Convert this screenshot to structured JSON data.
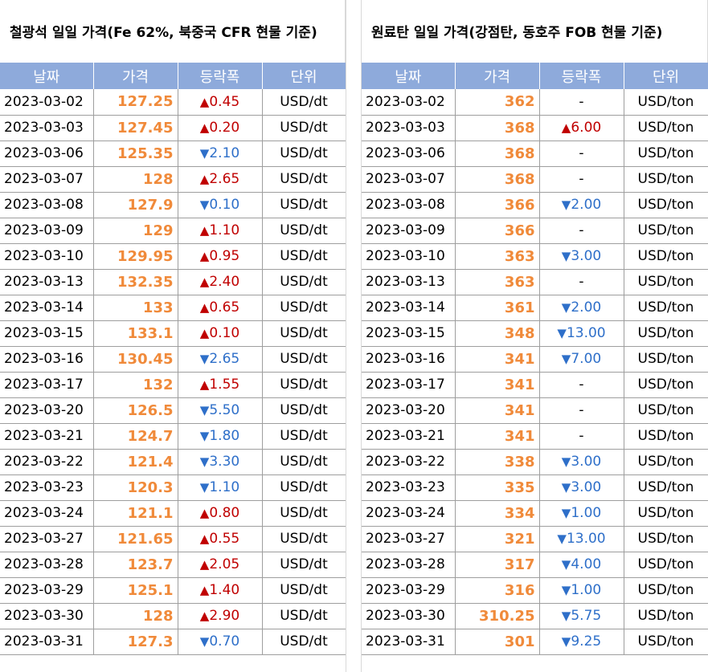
{
  "left": {
    "title": "철광석 일일 가격(Fe 62%, 북중국 CFR 현물 기준)",
    "headers": [
      "날짜",
      "가격",
      "등락폭",
      "단위"
    ],
    "rows": [
      {
        "date": "2023-03-02",
        "price": "127.25",
        "dir": "up",
        "change": "0.45",
        "unit": "USD/dt"
      },
      {
        "date": "2023-03-03",
        "price": "127.45",
        "dir": "up",
        "change": "0.20",
        "unit": "USD/dt"
      },
      {
        "date": "2023-03-06",
        "price": "125.35",
        "dir": "down",
        "change": "2.10",
        "unit": "USD/dt"
      },
      {
        "date": "2023-03-07",
        "price": "128",
        "dir": "up",
        "change": "2.65",
        "unit": "USD/dt"
      },
      {
        "date": "2023-03-08",
        "price": "127.9",
        "dir": "down",
        "change": "0.10",
        "unit": "USD/dt"
      },
      {
        "date": "2023-03-09",
        "price": "129",
        "dir": "up",
        "change": "1.10",
        "unit": "USD/dt"
      },
      {
        "date": "2023-03-10",
        "price": "129.95",
        "dir": "up",
        "change": "0.95",
        "unit": "USD/dt"
      },
      {
        "date": "2023-03-13",
        "price": "132.35",
        "dir": "up",
        "change": "2.40",
        "unit": "USD/dt"
      },
      {
        "date": "2023-03-14",
        "price": "133",
        "dir": "up",
        "change": "0.65",
        "unit": "USD/dt"
      },
      {
        "date": "2023-03-15",
        "price": "133.1",
        "dir": "up",
        "change": "0.10",
        "unit": "USD/dt"
      },
      {
        "date": "2023-03-16",
        "price": "130.45",
        "dir": "down",
        "change": "2.65",
        "unit": "USD/dt"
      },
      {
        "date": "2023-03-17",
        "price": "132",
        "dir": "up",
        "change": "1.55",
        "unit": "USD/dt"
      },
      {
        "date": "2023-03-20",
        "price": "126.5",
        "dir": "down",
        "change": "5.50",
        "unit": "USD/dt"
      },
      {
        "date": "2023-03-21",
        "price": "124.7",
        "dir": "down",
        "change": "1.80",
        "unit": "USD/dt"
      },
      {
        "date": "2023-03-22",
        "price": "121.4",
        "dir": "down",
        "change": "3.30",
        "unit": "USD/dt"
      },
      {
        "date": "2023-03-23",
        "price": "120.3",
        "dir": "down",
        "change": "1.10",
        "unit": "USD/dt"
      },
      {
        "date": "2023-03-24",
        "price": "121.1",
        "dir": "up",
        "change": "0.80",
        "unit": "USD/dt"
      },
      {
        "date": "2023-03-27",
        "price": "121.65",
        "dir": "up",
        "change": "0.55",
        "unit": "USD/dt"
      },
      {
        "date": "2023-03-28",
        "price": "123.7",
        "dir": "up",
        "change": "2.05",
        "unit": "USD/dt"
      },
      {
        "date": "2023-03-29",
        "price": "125.1",
        "dir": "up",
        "change": "1.40",
        "unit": "USD/dt"
      },
      {
        "date": "2023-03-30",
        "price": "128",
        "dir": "up",
        "change": "2.90",
        "unit": "USD/dt"
      },
      {
        "date": "2023-03-31",
        "price": "127.3",
        "dir": "down",
        "change": "0.70",
        "unit": "USD/dt"
      }
    ]
  },
  "right": {
    "title": "원료탄 일일 가격(강점탄, 동호주 FOB 현물 기준)",
    "headers": [
      "날짜",
      "가격",
      "등락폭",
      "단위"
    ],
    "rows": [
      {
        "date": "2023-03-02",
        "price": "362",
        "dir": "flat",
        "change": "-",
        "unit": "USD/ton"
      },
      {
        "date": "2023-03-03",
        "price": "368",
        "dir": "up",
        "change": "6.00",
        "unit": "USD/ton"
      },
      {
        "date": "2023-03-06",
        "price": "368",
        "dir": "flat",
        "change": "-",
        "unit": "USD/ton"
      },
      {
        "date": "2023-03-07",
        "price": "368",
        "dir": "flat",
        "change": "-",
        "unit": "USD/ton"
      },
      {
        "date": "2023-03-08",
        "price": "366",
        "dir": "down",
        "change": "2.00",
        "unit": "USD/ton"
      },
      {
        "date": "2023-03-09",
        "price": "366",
        "dir": "flat",
        "change": "-",
        "unit": "USD/ton"
      },
      {
        "date": "2023-03-10",
        "price": "363",
        "dir": "down",
        "change": "3.00",
        "unit": "USD/ton"
      },
      {
        "date": "2023-03-13",
        "price": "363",
        "dir": "flat",
        "change": "-",
        "unit": "USD/ton"
      },
      {
        "date": "2023-03-14",
        "price": "361",
        "dir": "down",
        "change": "2.00",
        "unit": "USD/ton"
      },
      {
        "date": "2023-03-15",
        "price": "348",
        "dir": "down",
        "change": "13.00",
        "unit": "USD/ton"
      },
      {
        "date": "2023-03-16",
        "price": "341",
        "dir": "down",
        "change": "7.00",
        "unit": "USD/ton"
      },
      {
        "date": "2023-03-17",
        "price": "341",
        "dir": "flat",
        "change": "-",
        "unit": "USD/ton"
      },
      {
        "date": "2023-03-20",
        "price": "341",
        "dir": "flat",
        "change": "-",
        "unit": "USD/ton"
      },
      {
        "date": "2023-03-21",
        "price": "341",
        "dir": "flat",
        "change": "-",
        "unit": "USD/ton"
      },
      {
        "date": "2023-03-22",
        "price": "338",
        "dir": "down",
        "change": "3.00",
        "unit": "USD/ton"
      },
      {
        "date": "2023-03-23",
        "price": "335",
        "dir": "down",
        "change": "3.00",
        "unit": "USD/ton"
      },
      {
        "date": "2023-03-24",
        "price": "334",
        "dir": "down",
        "change": "1.00",
        "unit": "USD/ton"
      },
      {
        "date": "2023-03-27",
        "price": "321",
        "dir": "down",
        "change": "13.00",
        "unit": "USD/ton"
      },
      {
        "date": "2023-03-28",
        "price": "317",
        "dir": "down",
        "change": "4.00",
        "unit": "USD/ton"
      },
      {
        "date": "2023-03-29",
        "price": "316",
        "dir": "down",
        "change": "1.00",
        "unit": "USD/ton"
      },
      {
        "date": "2023-03-30",
        "price": "310.25",
        "dir": "down",
        "change": "5.75",
        "unit": "USD/ton"
      },
      {
        "date": "2023-03-31",
        "price": "301",
        "dir": "down",
        "change": "9.25",
        "unit": "USD/ton"
      }
    ]
  },
  "arrows": {
    "up": "▲",
    "down": "▼"
  },
  "colors": {
    "header_bg": "#8eaadb",
    "price": "#f08a3a",
    "up": "#c00000",
    "down": "#2e6fc9"
  }
}
